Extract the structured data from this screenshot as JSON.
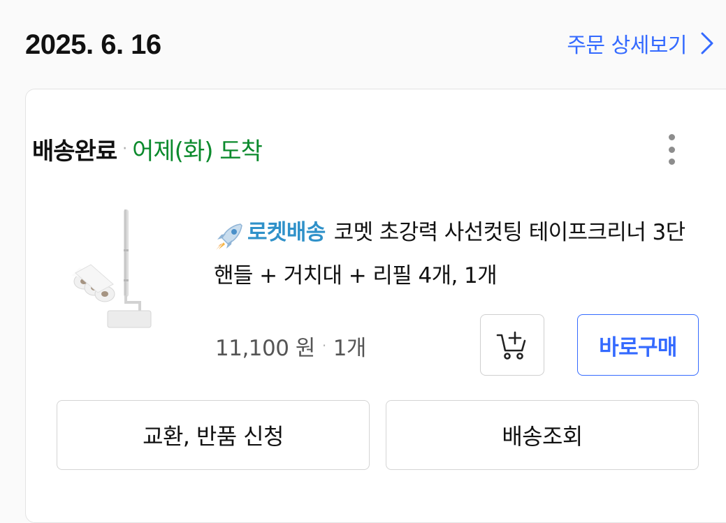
{
  "order": {
    "date": "2025. 6. 16",
    "detail_link_label": "주문 상세보기"
  },
  "status": {
    "main": "배송완료",
    "separator": "·",
    "sub": "어제(화) 도착",
    "sub_color": "#0b8a2c"
  },
  "product": {
    "badge_label": "로켓배송",
    "badge_icon": "rocket-icon",
    "name": "코멧 초강력 사선컷팅 테이프크리너 3단 핸들 + 거치대 + 리필 4개, 1개",
    "price": "11,100 원",
    "separator": "·",
    "quantity": "1개",
    "image_icon": "lint-roller-product-image"
  },
  "actions": {
    "cart_icon": "add-to-cart-icon",
    "buy_now_label": "바로구매",
    "return_label": "교환, 반품 신청",
    "tracking_label": "배송조회",
    "more_icon": "more-vertical-icon"
  },
  "colors": {
    "accent": "#346aff",
    "rocket": "#2f91c9",
    "status_green": "#0b8a2c"
  }
}
